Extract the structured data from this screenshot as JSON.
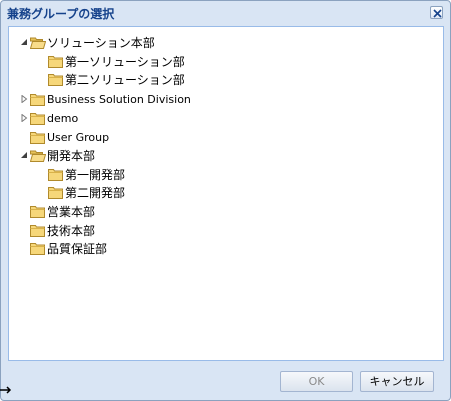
{
  "dialog": {
    "title": "兼務グループの選択",
    "close_icon": "close-icon"
  },
  "tree": {
    "nodes": [
      {
        "label": "ソリューション本部",
        "state": "expanded"
      },
      {
        "label": "第一ソリューション部",
        "state": "leaf"
      },
      {
        "label": "第二ソリューション部",
        "state": "leaf"
      },
      {
        "label": "Business Solution Division",
        "state": "collapsed"
      },
      {
        "label": "demo",
        "state": "collapsed"
      },
      {
        "label": "User Group",
        "state": "leaf"
      },
      {
        "label": "開発本部",
        "state": "expanded"
      },
      {
        "label": "第一開発部",
        "state": "leaf"
      },
      {
        "label": "第二開発部",
        "state": "leaf"
      },
      {
        "label": "営業本部",
        "state": "leaf"
      },
      {
        "label": "技術本部",
        "state": "leaf"
      },
      {
        "label": "品質保証部",
        "state": "leaf"
      }
    ]
  },
  "footer": {
    "ok_label": "OK",
    "cancel_label": "キャンセル",
    "ok_disabled": true
  },
  "colors": {
    "title_text": "#15428b",
    "frame_background": "#d9e5f4",
    "border": "#8ba2bf",
    "folder_fill": "#f6d77a"
  }
}
